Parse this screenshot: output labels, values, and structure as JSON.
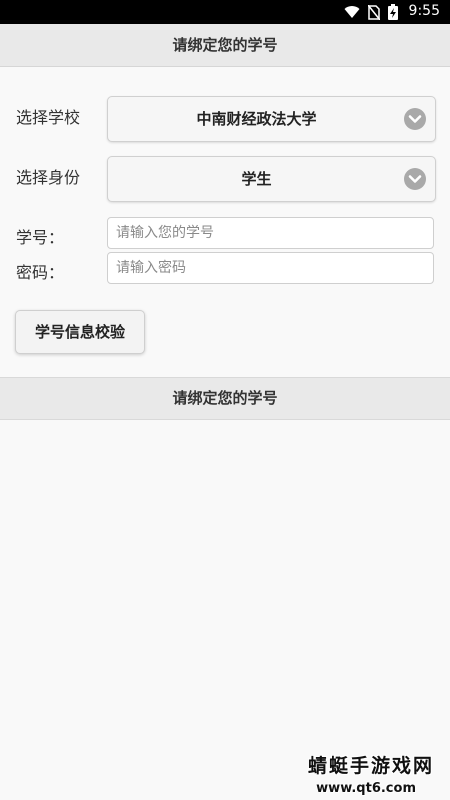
{
  "status_bar": {
    "time": "9:55",
    "icons": [
      "wifi-icon",
      "no-sim-icon",
      "battery-charging-icon"
    ]
  },
  "header": {
    "title": "请绑定您的学号"
  },
  "form": {
    "school": {
      "label": "选择学校",
      "value": "中南财经政法大学"
    },
    "identity": {
      "label": "选择身份",
      "value": "学生"
    },
    "student_id": {
      "label": "学号：",
      "placeholder": "请输入您的学号"
    },
    "password": {
      "label": "密码：",
      "placeholder": "请输入密码"
    },
    "verify_button": "学号信息校验"
  },
  "section": {
    "title": "请绑定您的学号"
  },
  "watermark": {
    "line1": "蜻蜓手游戏网",
    "line2": "www.qt6.com"
  }
}
